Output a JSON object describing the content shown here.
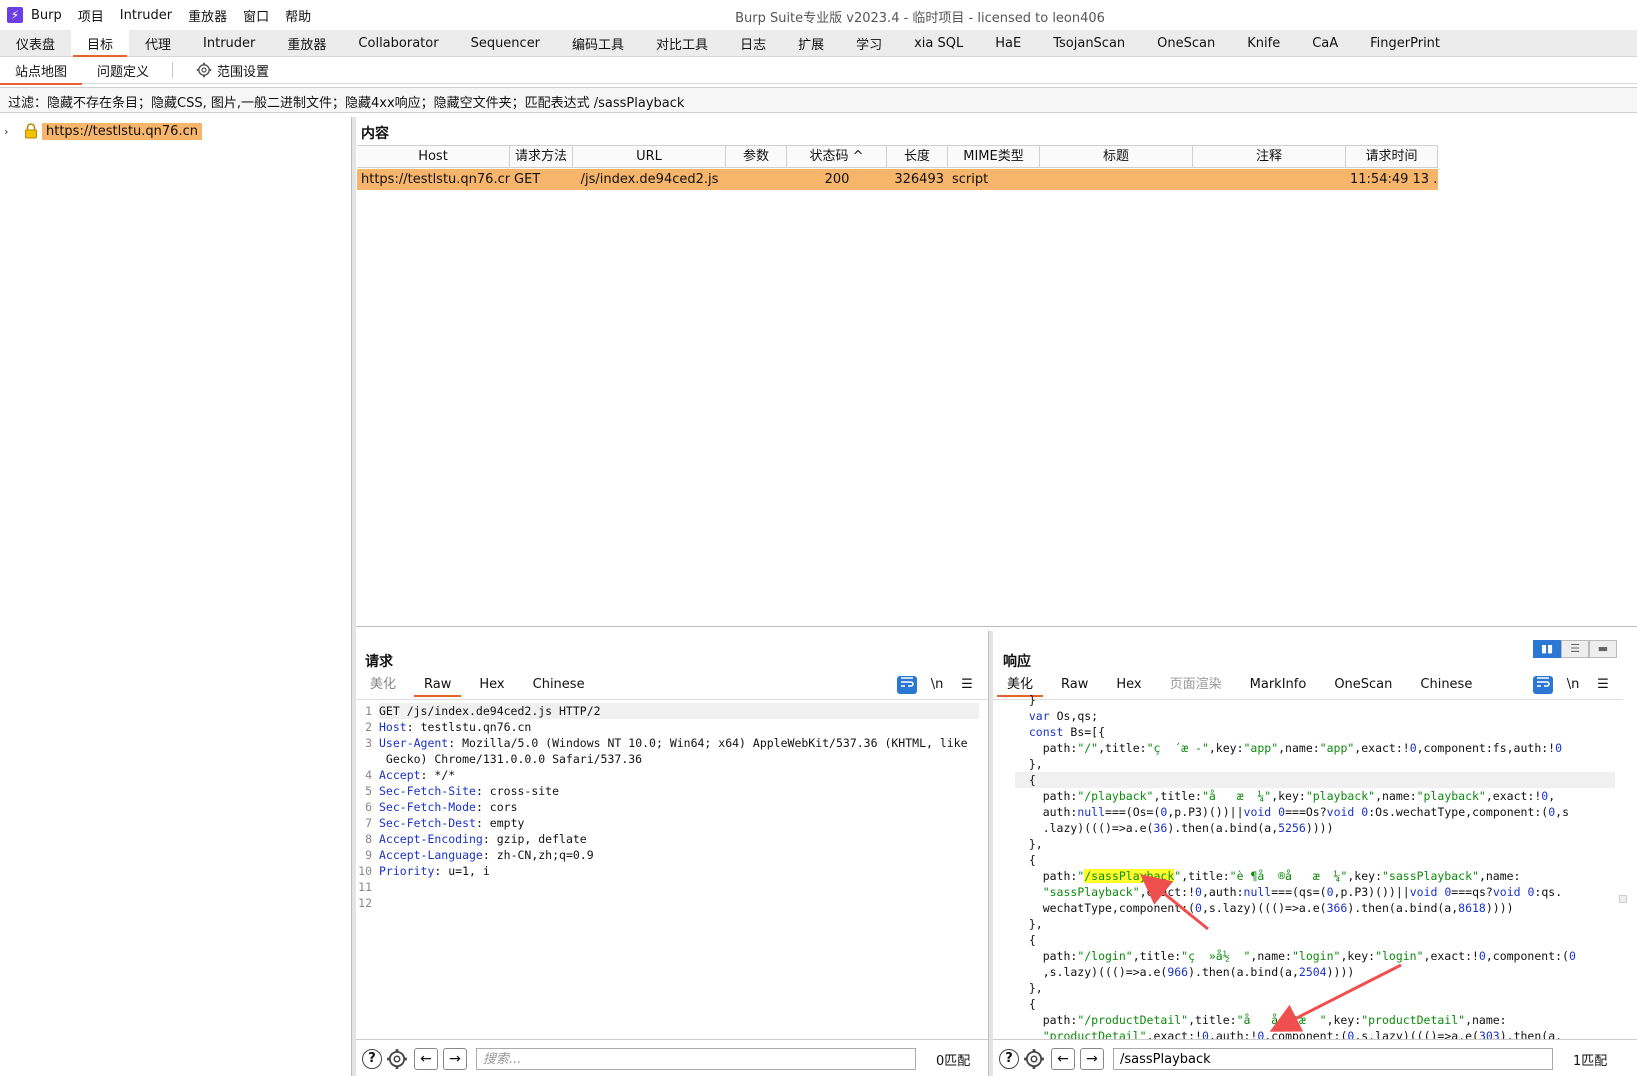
{
  "titlebar": {
    "logo": "⚡",
    "menu": [
      "Burp",
      "项目",
      "Intruder",
      "重放器",
      "窗口",
      "帮助"
    ],
    "title": "Burp Suite专业版  v2023.4 - 临时项目 - licensed to leon406"
  },
  "main_tabs": [
    "仪表盘",
    "目标",
    "代理",
    "Intruder",
    "重放器",
    "Collaborator",
    "Sequencer",
    "编码工具",
    "对比工具",
    "日志",
    "扩展",
    "学习",
    "xia SQL",
    "HaE",
    "TsojanScan",
    "OneScan",
    "Knife",
    "CaA",
    "FingerPrint"
  ],
  "main_tab_active": 1,
  "sub_tabs": {
    "site_map": "站点地图",
    "issues": "问题定义",
    "scope": "范围设置"
  },
  "filter": "过滤：隐藏不存在条目；隐藏CSS, 图片,一般二进制文件；隐藏4xx响应；隐藏空文件夹；匹配表达式 /sassPlayback",
  "tree": {
    "chevron": "›",
    "host": "https://testlstu.qn76.cn"
  },
  "content": {
    "title": "内容",
    "columns": [
      "Host",
      "请求方法",
      "URL",
      "参数",
      "状态码 ^",
      "长度",
      "MIME类型",
      "标题",
      "注释",
      "请求时间"
    ],
    "row": [
      "https://testlstu.qn76.cn",
      "GET",
      "/js/index.de94ced2.js",
      "",
      "200",
      "326493",
      "script",
      "",
      "",
      "11:54:49 13 ..."
    ]
  },
  "request": {
    "title": "请求",
    "tabs": [
      "美化",
      "Raw",
      "Hex",
      "Chinese"
    ],
    "active_tab": 1,
    "newline_toggle": "\\n",
    "lines": [
      {
        "n": "1",
        "name": "",
        "value": "GET /js/index.de94ced2.js HTTP/2"
      },
      {
        "n": "2",
        "name": "Host",
        "value": " testlstu.qn76.cn"
      },
      {
        "n": "3",
        "name": "User-Agent",
        "value": " Mozilla/5.0 (Windows NT 10.0; Win64; x64) AppleWebKit/537.36 (KHTML, like"
      },
      {
        "n": "",
        "name": "",
        "value": " Gecko) Chrome/131.0.0.0 Safari/537.36"
      },
      {
        "n": "4",
        "name": "Accept",
        "value": " */*"
      },
      {
        "n": "5",
        "name": "Sec-Fetch-Site",
        "value": " cross-site"
      },
      {
        "n": "6",
        "name": "Sec-Fetch-Mode",
        "value": " cors"
      },
      {
        "n": "7",
        "name": "Sec-Fetch-Dest",
        "value": " empty"
      },
      {
        "n": "8",
        "name": "Accept-Encoding",
        "value": " gzip, deflate"
      },
      {
        "n": "9",
        "name": "Accept-Language",
        "value": " zh-CN,zh;q=0.9"
      },
      {
        "n": "10",
        "name": "Priority",
        "value": " u=1, i"
      },
      {
        "n": "11",
        "name": "",
        "value": ""
      },
      {
        "n": "12",
        "name": "",
        "value": ""
      }
    ],
    "search_placeholder": "搜索...",
    "search_value": "",
    "match_count": "0匹配"
  },
  "response": {
    "title": "响应",
    "tabs": [
      "美化",
      "Raw",
      "Hex",
      "页面渲染",
      "MarkInfo",
      "OneScan",
      "Chinese"
    ],
    "active_tab": 0,
    "newline_toggle": "\\n",
    "search_value": "/sassPlayback",
    "match_count": "1匹配",
    "code": [
      "  }",
      "  var Os,qs;",
      "  const Bs=[{",
      "    path:\"/\",title:\"ç  ´æ -\",key:\"app\",name:\"app\",exact:!0,component:fs,auth:!0",
      "  },",
      "  {",
      "    path:\"/playback\",title:\"å   æ  ¼\",key:\"playback\",name:\"playback\",exact:!0,",
      "    auth:null===(Os=(0,p.P3)())||void 0===Os?void 0:Os.wechatType,component:(0,s",
      "    .lazy)((()=>a.e(36).then(a.bind(a,5256))))",
      "  },",
      "  {",
      "    path:\"/sassPlayback\",title:\"è ¶å  ®å   æ  ¼\",key:\"sassPlayback\",name:",
      "    \"sassPlayback\",exact:!0,auth:null===(qs=(0,p.P3)())||void 0===qs?void 0:qs.",
      "    wechatType,component:(0,s.lazy)((()=>a.e(366).then(a.bind(a,8618))))",
      "  },",
      "  {",
      "    path:\"/login\",title:\"ç  »å½  \",name:\"login\",key:\"login\",exact:!0,component:(0",
      "    ,s.lazy)((()=>a.e(966).then(a.bind(a,2504))))",
      "  },",
      "  {",
      "    path:\"/productDetail\",title:\"å   å  ¦æ  \",key:\"productDetail\",name:",
      "    \"productDetail\",exact:!0,auth:!0,component:(0,s.lazy)((()=>a.e(303).then(a."
    ]
  },
  "colors": {
    "accent": "#e8632b",
    "selection": "#f6b56b",
    "highlight": "#ffff2e",
    "header_name": "#1a32c8",
    "string": "#0b8a0b",
    "annotation_arrow": "#f04f4f"
  },
  "icons": [
    "lightning-logo-icon",
    "gear-icon",
    "lock-icon",
    "help-icon",
    "arrow-left-icon",
    "arrow-right-icon",
    "wrap-icon",
    "menu-icon",
    "layout-icon"
  ]
}
